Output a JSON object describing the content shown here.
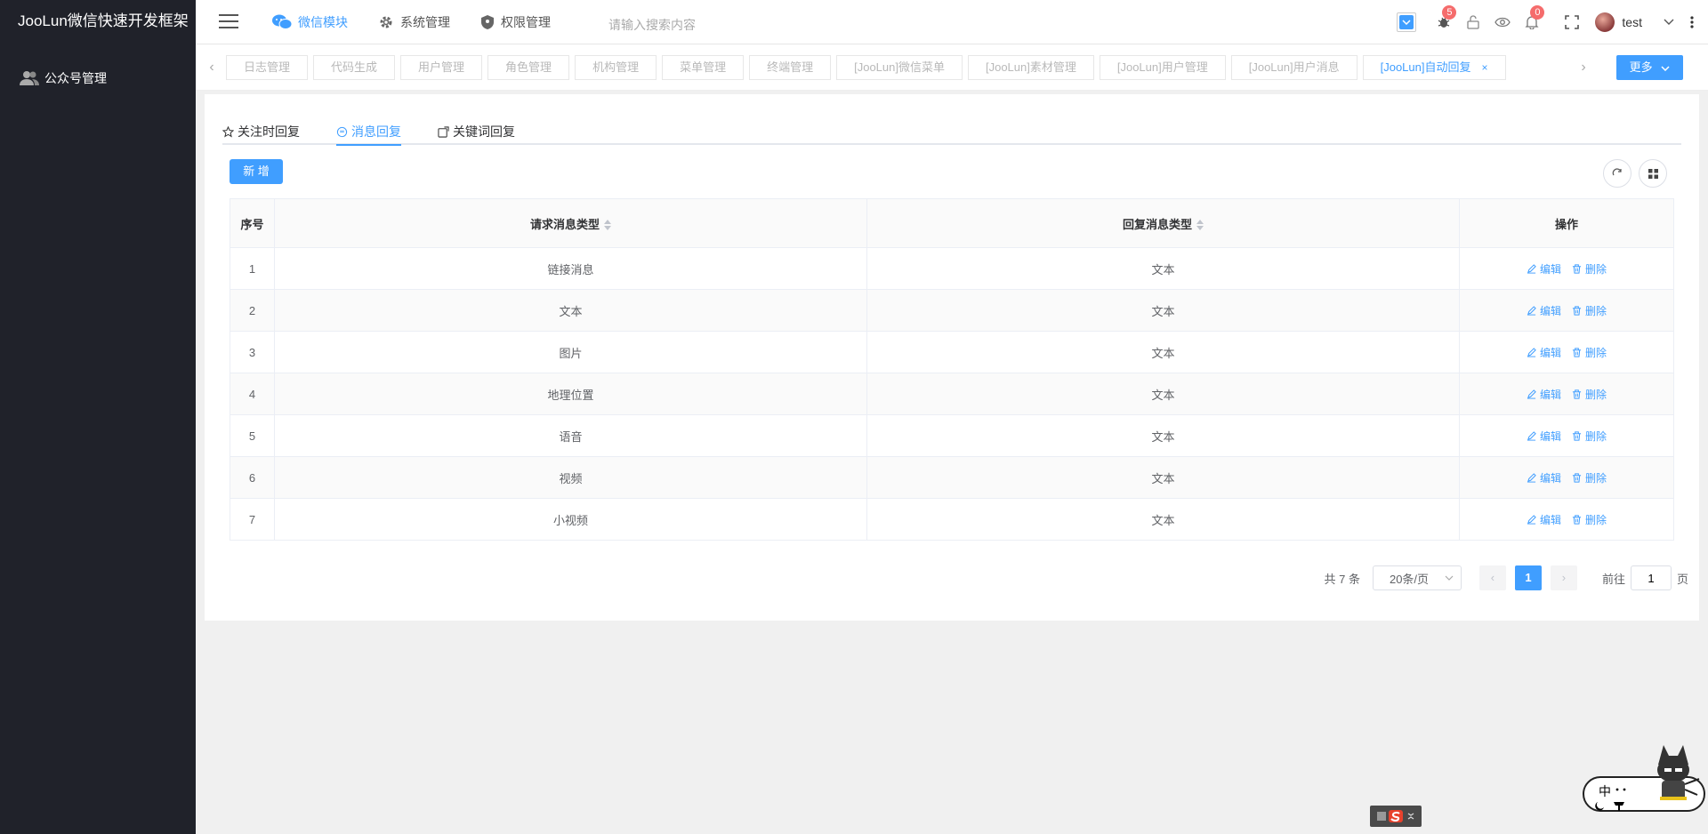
{
  "app": {
    "title": "JooLun微信快速开发框架"
  },
  "sidebar": {
    "items": [
      {
        "label": "公众号管理",
        "icon": "users-icon"
      }
    ]
  },
  "topnav": {
    "items": [
      {
        "label": "微信模块",
        "icon": "wechat-icon",
        "active": true
      },
      {
        "label": "系统管理",
        "icon": "gear-icon",
        "active": false
      },
      {
        "label": "权限管理",
        "icon": "shield-icon",
        "active": false
      }
    ],
    "search_placeholder": "请输入搜索内容"
  },
  "header": {
    "bug_badge": "5",
    "notice_badge": "0",
    "user_name": "test"
  },
  "tabs": {
    "items": [
      {
        "label": "日志管理",
        "active": false
      },
      {
        "label": "代码生成",
        "active": false
      },
      {
        "label": "用户管理",
        "active": false
      },
      {
        "label": "角色管理",
        "active": false
      },
      {
        "label": "机构管理",
        "active": false
      },
      {
        "label": "菜单管理",
        "active": false
      },
      {
        "label": "终端管理",
        "active": false
      },
      {
        "label": "[JooLun]微信菜单",
        "active": false
      },
      {
        "label": "[JooLun]素材管理",
        "active": false
      },
      {
        "label": "[JooLun]用户管理",
        "active": false
      },
      {
        "label": "[JooLun]用户消息",
        "active": false
      },
      {
        "label": "[JooLun]自动回复",
        "active": true
      }
    ],
    "close_symbol": "×",
    "more_label": "更多"
  },
  "subtabs": [
    {
      "label": "关注时回复",
      "icon": "star-icon"
    },
    {
      "label": "消息回复",
      "icon": "chat-icon",
      "active": true
    },
    {
      "label": "关键词回复",
      "icon": "edit-box-icon"
    }
  ],
  "toolbar": {
    "add_label": "新 增"
  },
  "table": {
    "headers": {
      "index": "序号",
      "request_type": "请求消息类型",
      "reply_type": "回复消息类型",
      "actions": "操作"
    },
    "edit_label": "编辑",
    "delete_label": "删除",
    "rows": [
      {
        "index": "1",
        "request_type": "链接消息",
        "reply_type": "文本"
      },
      {
        "index": "2",
        "request_type": "文本",
        "reply_type": "文本"
      },
      {
        "index": "3",
        "request_type": "图片",
        "reply_type": "文本"
      },
      {
        "index": "4",
        "request_type": "地理位置",
        "reply_type": "文本"
      },
      {
        "index": "5",
        "request_type": "语音",
        "reply_type": "文本"
      },
      {
        "index": "6",
        "request_type": "视频",
        "reply_type": "文本"
      },
      {
        "index": "7",
        "request_type": "小视频",
        "reply_type": "文本"
      }
    ]
  },
  "pagination": {
    "total": "共 7 条",
    "page_size": "20条/页",
    "current_page": "1",
    "goto_label": "前往",
    "goto_value": "1",
    "page_unit": "页"
  },
  "widget": {
    "ime_char": "中"
  },
  "colors": {
    "primary": "#409eff",
    "sidebar": "#20222a",
    "badge": "#f56c6c"
  }
}
